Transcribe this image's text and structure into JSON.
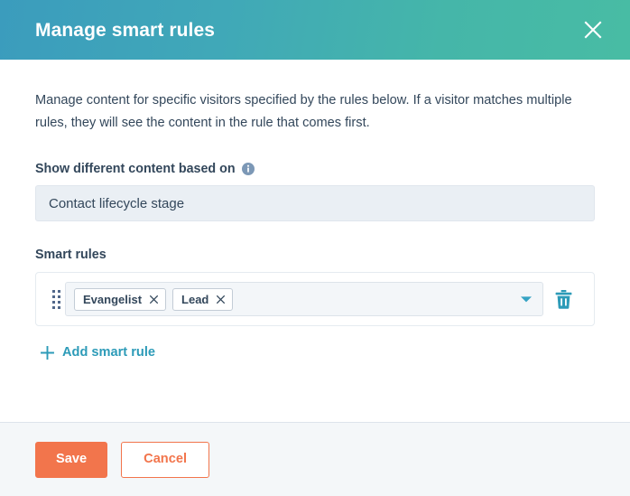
{
  "header": {
    "title": "Manage smart rules",
    "close_icon": "close-icon",
    "gradient_start": "#3b9cbd",
    "gradient_end": "#48bca4"
  },
  "body": {
    "intro": "Manage content for specific visitors specified by the rules below. If a visitor matches multiple rules, they will see the content in the rule that comes first.",
    "criteria": {
      "label": "Show different content based on",
      "info_icon": "info-circle-icon",
      "value": "Contact lifecycle stage"
    },
    "smart_rules": {
      "label": "Smart rules",
      "rows": [
        {
          "drag_icon": "drag-handle-icon",
          "tags": [
            {
              "label": "Evangelist",
              "remove_icon": "close-icon"
            },
            {
              "label": "Lead",
              "remove_icon": "close-icon"
            }
          ],
          "caret_icon": "chevron-down-icon",
          "delete_icon": "trash-icon"
        }
      ],
      "add_label": "Add smart rule",
      "add_icon": "plus-icon",
      "accent_color": "#2d9bb8"
    }
  },
  "footer": {
    "save_label": "Save",
    "cancel_label": "Cancel",
    "primary_color": "#f2754c"
  }
}
